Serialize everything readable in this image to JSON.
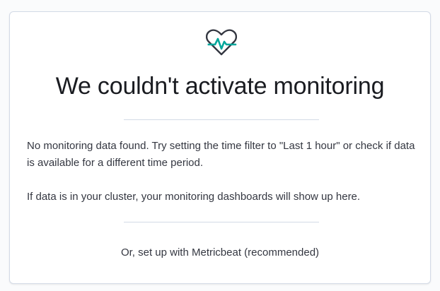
{
  "empty_state": {
    "icon": "heart-pulse-icon",
    "title": "We couldn't activate monitoring",
    "body": {
      "line1": "No monitoring data found. Try setting the time filter to \"Last 1 hour\" or check if data is available for a different time period.",
      "line2": "If data is in your cluster, your monitoring dashboards will show up here."
    },
    "setup_link": "Or, set up with Metricbeat (recommended)"
  },
  "colors": {
    "icon_dark": "#343741",
    "icon_accent": "#00a69b",
    "text": "#343741",
    "title": "#1a1c21",
    "border": "#d3dae6"
  }
}
